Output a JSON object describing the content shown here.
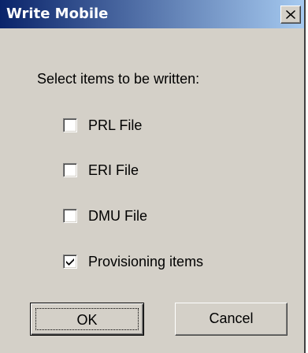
{
  "window": {
    "title": "Write Mobile",
    "close_icon": "close-x-icon"
  },
  "prompt": "Select items to be written:",
  "items": [
    {
      "label": "PRL File",
      "checked": false
    },
    {
      "label": "ERI File",
      "checked": false
    },
    {
      "label": "DMU File",
      "checked": false
    },
    {
      "label": "Provisioning items",
      "checked": true
    }
  ],
  "buttons": {
    "ok_label": "OK",
    "cancel_label": "Cancel"
  },
  "colors": {
    "titlebar_start": "#0a246a",
    "titlebar_end": "#a6caf0",
    "dialog_face": "#d4d0c8"
  }
}
